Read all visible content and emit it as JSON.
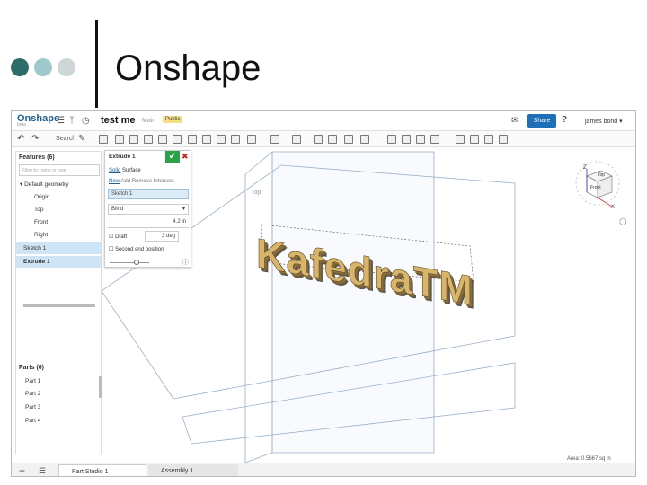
{
  "slide": {
    "title": "Onshape"
  },
  "app": {
    "logo": "Onshape",
    "logo_sub": "beta",
    "doc_name": "test me",
    "branch": "Main",
    "badge": "Public",
    "share_label": "Share",
    "help_label": "?",
    "user": "james bond ▾",
    "search_label": "Search"
  },
  "features": {
    "title": "Features (6)",
    "filter_placeholder": "Filter by name or type",
    "default_geometry": "Default geometry",
    "items": [
      "Origin",
      "Top",
      "Front",
      "Right"
    ],
    "sketch": "Sketch 1",
    "extrude": "Extrude 1"
  },
  "parts": {
    "title": "Parts (6)",
    "items": [
      "Part 1",
      "Part 2",
      "Part 3",
      "Part 4"
    ]
  },
  "extrude_dialog": {
    "title": "Extrude 1",
    "ok": "✔",
    "cancel": "✖",
    "solid": "Solid",
    "surface": "Surface",
    "op_new": "New",
    "op_rest": "Add Remove Intersect",
    "sketch_field": "Sketch 1",
    "end_type": "Blind",
    "depth": "4.2 in",
    "draft_label": "Draft",
    "draft_value": "3 deg",
    "second_end": "Second end position"
  },
  "viewport": {
    "text_3d": "KafedraTM",
    "view_front": "Front",
    "view_top": "Top",
    "axis_z": "Z",
    "axis_x": "X"
  },
  "bottom": {
    "tab_part_studio": "Part Studio 1",
    "tab_assembly": "Assembly 1",
    "area": "Area: 0.5667 sq in"
  },
  "colors": {
    "accent": "#1f6fb6",
    "ok": "#2da04a",
    "selection": "#cfe5f5"
  }
}
